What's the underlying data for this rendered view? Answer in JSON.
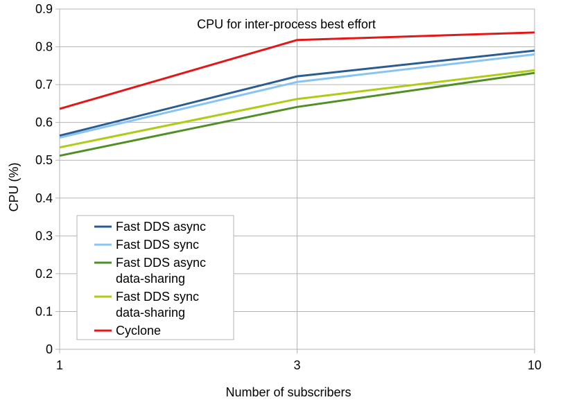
{
  "chart_data": {
    "type": "line",
    "title": "CPU for inter-process best effort",
    "xlabel": "Number of subscribers",
    "ylabel": "CPU (%)",
    "x": [
      "1",
      "3",
      "10"
    ],
    "ylim": [
      0,
      0.9
    ],
    "yticks": [
      "0",
      "0.1",
      "0.2",
      "0.3",
      "0.4",
      "0.5",
      "0.6",
      "0.7",
      "0.8",
      "0.9"
    ],
    "grid": true,
    "legend_position": "bottom-left",
    "series": [
      {
        "name": "Fast DDS async",
        "name_lines": [
          "Fast DDS async"
        ],
        "color": "#2b5c8f",
        "values": [
          0.565,
          0.722,
          0.79
        ]
      },
      {
        "name": "Fast DDS sync",
        "name_lines": [
          "Fast DDS sync"
        ],
        "color": "#87c3f3",
        "values": [
          0.56,
          0.707,
          0.78
        ]
      },
      {
        "name": "Fast DDS async data-sharing",
        "name_lines": [
          "Fast DDS async",
          "data-sharing"
        ],
        "color": "#4f8f25",
        "values": [
          0.512,
          0.641,
          0.731
        ]
      },
      {
        "name": "Fast DDS sync data-sharing",
        "name_lines": [
          "Fast DDS sync",
          "data-sharing"
        ],
        "color": "#aecb16",
        "values": [
          0.534,
          0.662,
          0.738
        ]
      },
      {
        "name": "Cyclone",
        "name_lines": [
          "Cyclone"
        ],
        "color": "#e31717",
        "values": [
          0.636,
          0.818,
          0.838
        ]
      }
    ]
  }
}
